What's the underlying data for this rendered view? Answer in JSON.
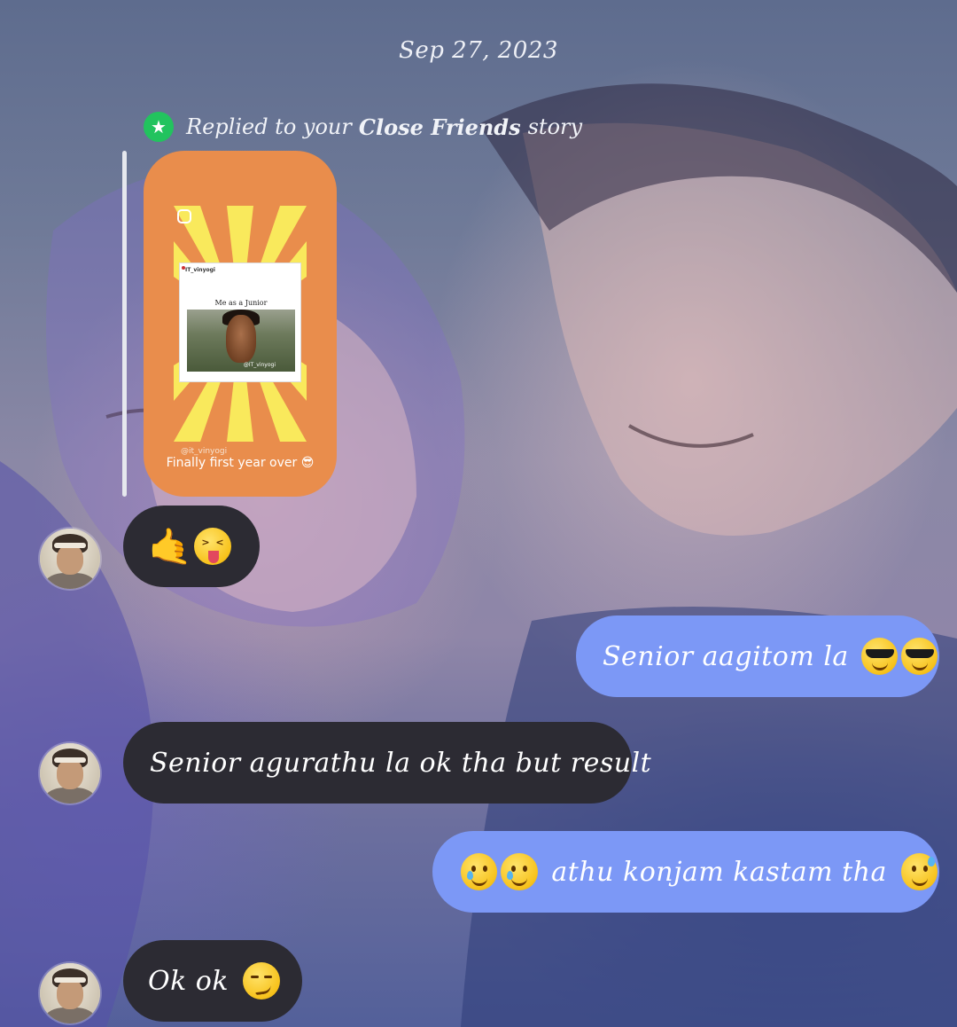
{
  "thread": {
    "date": "Sep 27, 2023",
    "reply_context": {
      "prefix": "Replied to your",
      "story_type": "Close Friends",
      "suffix": "story"
    },
    "story_preview": {
      "meme_handle": "IT_vinyogi",
      "meme_caption": "Me as a Junior",
      "meme_watermark": "@IT_vinyogi",
      "story_handle": "@it_vinyogi",
      "caption": "Finally first year over 😎"
    },
    "messages": [
      {
        "from": "them",
        "text": "",
        "emojis": [
          "call-me-hand",
          "squinting-tongue-face"
        ]
      },
      {
        "from": "me",
        "text": "Senior aagitom la",
        "emojis": [
          "sunglasses-face",
          "sunglasses-face"
        ]
      },
      {
        "from": "them",
        "text": "Senior agurathu la ok tha but result",
        "emojis": []
      },
      {
        "from": "me",
        "text": "athu konjam kastam tha",
        "emojis": [
          "holding-back-tears-face",
          "holding-back-tears-face",
          "grinning-sweat-face"
        ]
      },
      {
        "from": "them",
        "text": "Ok ok",
        "emojis": [
          "smirking-face"
        ]
      }
    ]
  },
  "colors": {
    "sent_bubble": "#7c98f6",
    "received_bubble": "#2c2b33",
    "close_friends_badge": "#22c35e",
    "story_card": "#e98d4c"
  }
}
